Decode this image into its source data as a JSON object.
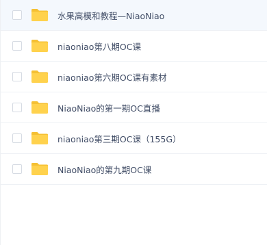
{
  "files": [
    {
      "name": "水果高模和教程—NiaoNiao",
      "icon": "folder-icon",
      "highlighted": true
    },
    {
      "name": "niaoniao第八期OC课",
      "icon": "folder-icon"
    },
    {
      "name": "niaoniao第六期OC课有素材",
      "icon": "folder-icon"
    },
    {
      "name": "NiaoNiao的第一期OC直播",
      "icon": "folder-icon"
    },
    {
      "name": "niaoniao第三期OC课（155G）",
      "icon": "folder-icon"
    },
    {
      "name": "NiaoNiao的第九期OC课",
      "icon": "folder-icon"
    }
  ],
  "colors": {
    "folder": "#ffd24d",
    "folder_tab": "#f5c033",
    "row_highlight": "#f4f8fd",
    "text": "#424e67"
  }
}
